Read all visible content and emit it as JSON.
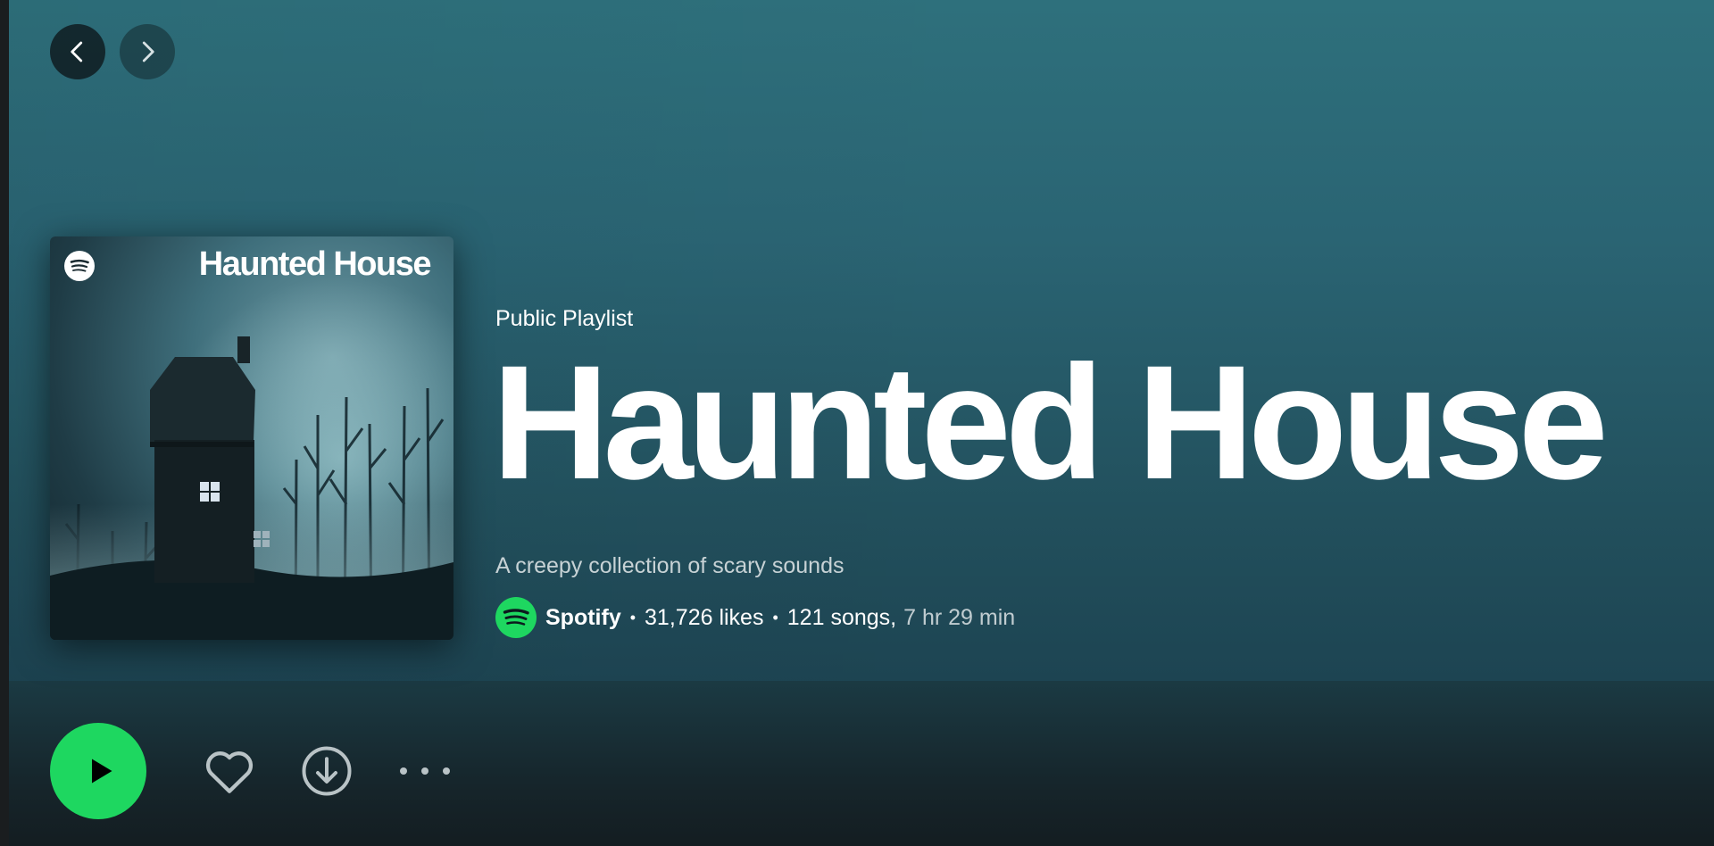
{
  "nav": {
    "back_icon": "chevron-left-icon",
    "forward_icon": "chevron-right-icon"
  },
  "cover": {
    "title": "Haunted House",
    "logo_icon": "spotify-logo-icon"
  },
  "playlist": {
    "type": "Public Playlist",
    "title": "Haunted House",
    "description": "A creepy collection of scary sounds",
    "owner": "Spotify",
    "likes": "31,726 likes",
    "songs": "121 songs,",
    "duration": "7 hr 29 min"
  },
  "actions": {
    "play_icon": "play-icon",
    "like_icon": "heart-icon",
    "download_icon": "download-icon",
    "more_icon": "more-options-icon"
  },
  "colors": {
    "accent": "#1ed760",
    "hero_top": "#2e707c",
    "hero_bottom": "#1d4452",
    "background": "#141d21"
  }
}
